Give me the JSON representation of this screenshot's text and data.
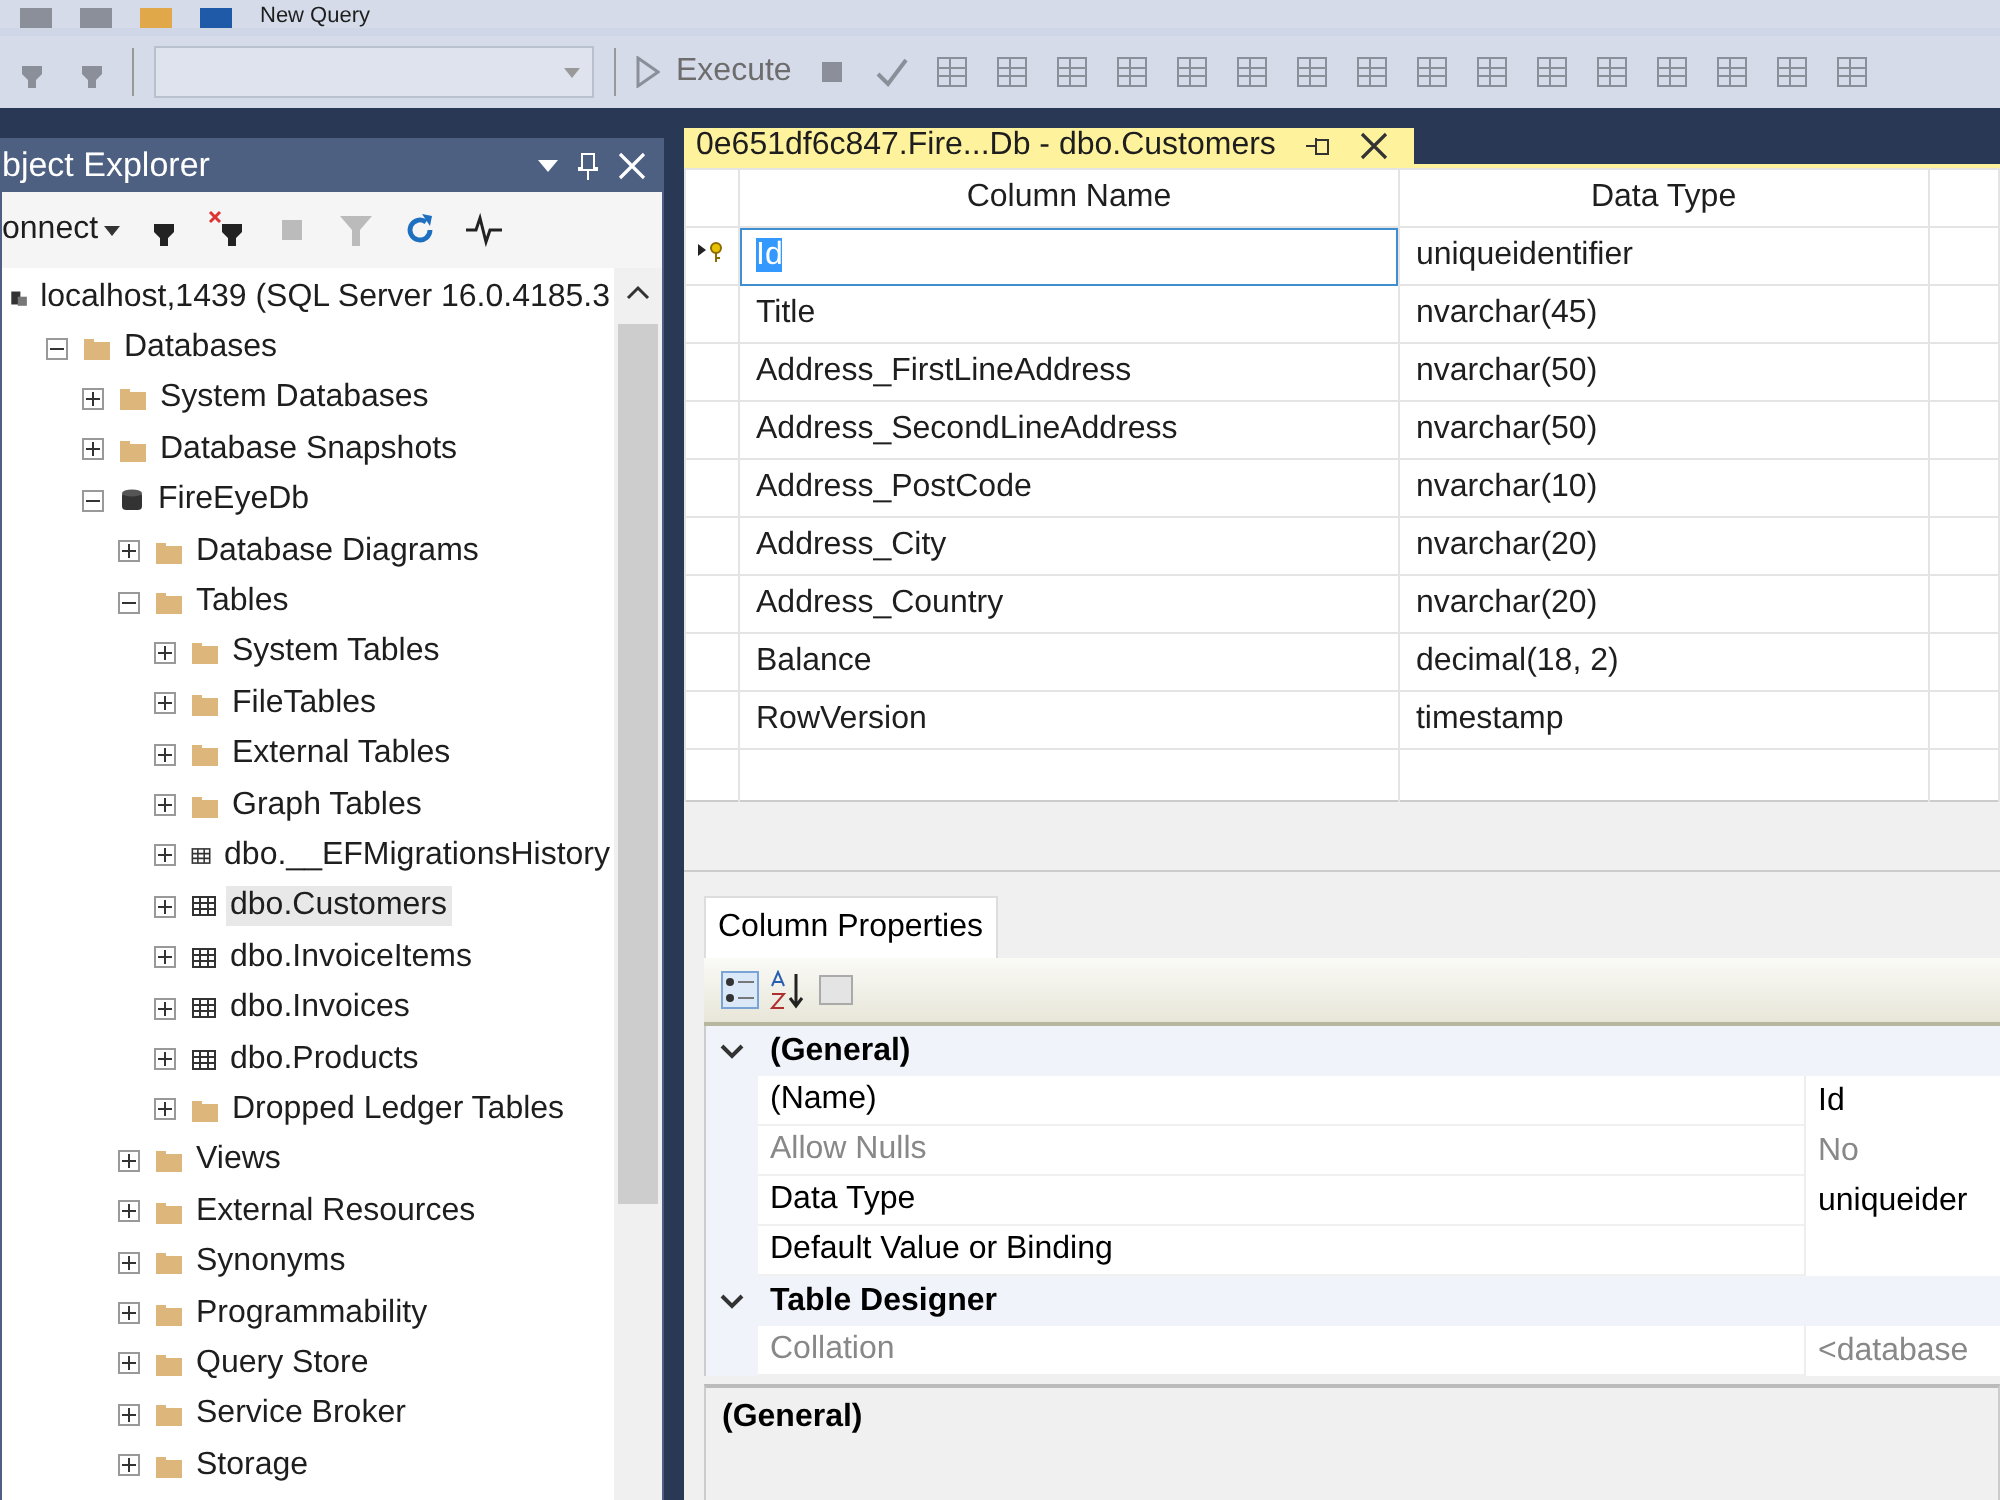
{
  "toolbar": {
    "new_query": "New Query",
    "execute": "Execute"
  },
  "object_explorer": {
    "title": "bject Explorer",
    "connect": "onnect",
    "tree": [
      {
        "label": "localhost,1439 (SQL Server 16.0.4185.3",
        "kind": "server",
        "selected": false,
        "children": [
          {
            "label": "Databases",
            "kind": "folder",
            "expanded": true,
            "selected": false,
            "children": [
              {
                "label": "System Databases",
                "kind": "folder",
                "expanded": false,
                "selected": false
              },
              {
                "label": "Database Snapshots",
                "kind": "folder",
                "expanded": false,
                "selected": false
              },
              {
                "label": "FireEyeDb",
                "kind": "database",
                "expanded": true,
                "selected": false,
                "children": [
                  {
                    "label": "Database Diagrams",
                    "kind": "folder",
                    "expanded": false,
                    "selected": false
                  },
                  {
                    "label": "Tables",
                    "kind": "folder",
                    "expanded": true,
                    "selected": false,
                    "children": [
                      {
                        "label": "System Tables",
                        "kind": "folder",
                        "expanded": false,
                        "selected": false
                      },
                      {
                        "label": "FileTables",
                        "kind": "folder",
                        "expanded": false,
                        "selected": false
                      },
                      {
                        "label": "External Tables",
                        "kind": "folder",
                        "expanded": false,
                        "selected": false
                      },
                      {
                        "label": "Graph Tables",
                        "kind": "folder",
                        "expanded": false,
                        "selected": false
                      },
                      {
                        "label": "dbo.__EFMigrationsHistory",
                        "kind": "table",
                        "expanded": false,
                        "selected": false
                      },
                      {
                        "label": "dbo.Customers",
                        "kind": "table",
                        "expanded": false,
                        "selected": true
                      },
                      {
                        "label": "dbo.InvoiceItems",
                        "kind": "table",
                        "expanded": false,
                        "selected": false
                      },
                      {
                        "label": "dbo.Invoices",
                        "kind": "table",
                        "expanded": false,
                        "selected": false
                      },
                      {
                        "label": "dbo.Products",
                        "kind": "table",
                        "expanded": false,
                        "selected": false
                      },
                      {
                        "label": "Dropped Ledger Tables",
                        "kind": "folder",
                        "expanded": false,
                        "selected": false
                      }
                    ]
                  },
                  {
                    "label": "Views",
                    "kind": "folder",
                    "expanded": false,
                    "selected": false
                  },
                  {
                    "label": "External Resources",
                    "kind": "folder",
                    "expanded": false,
                    "selected": false
                  },
                  {
                    "label": "Synonyms",
                    "kind": "folder",
                    "expanded": false,
                    "selected": false
                  },
                  {
                    "label": "Programmability",
                    "kind": "folder",
                    "expanded": false,
                    "selected": false
                  },
                  {
                    "label": "Query Store",
                    "kind": "folder",
                    "expanded": false,
                    "selected": false
                  },
                  {
                    "label": "Service Broker",
                    "kind": "folder",
                    "expanded": false,
                    "selected": false
                  },
                  {
                    "label": "Storage",
                    "kind": "folder",
                    "expanded": false,
                    "selected": false
                  }
                ]
              }
            ]
          }
        ]
      }
    ]
  },
  "document_tab": {
    "title": "0e651df6c847.Fire...Db - dbo.Customers",
    "selected": true
  },
  "table": {
    "columns": [
      "Column Name",
      "Data Type"
    ],
    "rows": [
      {
        "name": "Id",
        "type": "uniqueidentifier",
        "selected": true,
        "primary_key": true
      },
      {
        "name": "Title",
        "type": "nvarchar(45)",
        "selected": false,
        "primary_key": false
      },
      {
        "name": "Address_FirstLineAddress",
        "type": "nvarchar(50)",
        "selected": false,
        "primary_key": false
      },
      {
        "name": "Address_SecondLineAddress",
        "type": "nvarchar(50)",
        "selected": false,
        "primary_key": false
      },
      {
        "name": "Address_PostCode",
        "type": "nvarchar(10)",
        "selected": false,
        "primary_key": false
      },
      {
        "name": "Address_City",
        "type": "nvarchar(20)",
        "selected": false,
        "primary_key": false
      },
      {
        "name": "Address_Country",
        "type": "nvarchar(20)",
        "selected": false,
        "primary_key": false
      },
      {
        "name": "Balance",
        "type": "decimal(18, 2)",
        "selected": false,
        "primary_key": false
      },
      {
        "name": "RowVersion",
        "type": "timestamp",
        "selected": false,
        "primary_key": false
      }
    ]
  },
  "column_properties": {
    "tab": "Column Properties",
    "sections": [
      {
        "title": "(General)",
        "expanded": true,
        "properties": [
          {
            "name": "(Name)",
            "value": "Id",
            "disabled": false
          },
          {
            "name": "Allow Nulls",
            "value": "No",
            "disabled": true
          },
          {
            "name": "Data Type",
            "value": "uniqueider",
            "disabled": false
          },
          {
            "name": "Default Value or Binding",
            "disabled": false
          }
        ]
      },
      {
        "title": "Table Designer",
        "expanded": true,
        "properties": [
          {
            "name": "Collation",
            "value": "<database",
            "disabled": true
          }
        ]
      }
    ],
    "description_title": "(General)"
  }
}
